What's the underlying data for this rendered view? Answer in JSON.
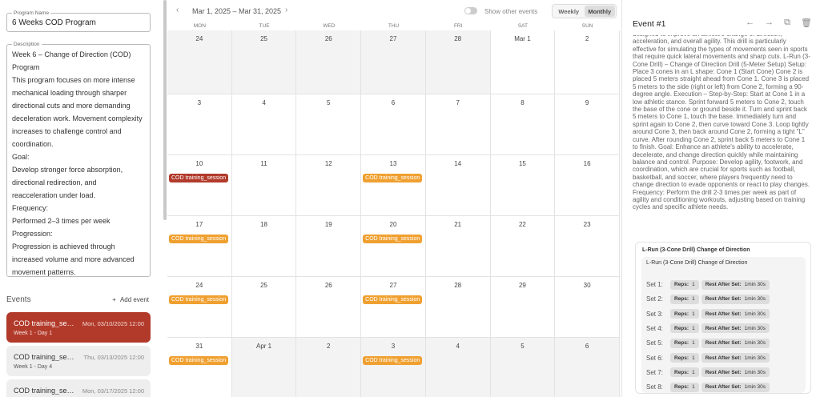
{
  "program": {
    "name_label": "Program Name",
    "name_value": "6 Weeks COD Program",
    "description_label": "Description",
    "description_lines": [
      "Week 6 – Change of Direction (COD)",
      "Program",
      "This program focuses on more intense",
      "mechanical loading through sharper",
      "directional cuts and more demanding",
      "deceleration work. Movement complexity",
      "increases to challenge control and",
      "coordination.",
      "Goal:",
      "Develop stronger force absorption,",
      "directional redirection, and",
      "reacceleration under load.",
      "Frequency:",
      "Performed 2–3 times per week",
      "Progression:",
      "Progression is achieved through",
      "increased volume and more advanced",
      "movement patterns."
    ]
  },
  "events_panel": {
    "title": "Events",
    "add_label": "Add event",
    "add_icon": "plus-icon",
    "items": [
      {
        "title": "COD training_session",
        "date": "Mon, 03/10/2025 12:00",
        "sub": "Week 1 - Day 1",
        "active": true
      },
      {
        "title": "COD training_session",
        "date": "Thu, 03/13/2025 12:00",
        "sub": "Week 1 - Day 4",
        "active": false
      },
      {
        "title": "COD training_session",
        "date": "Mon, 03/17/2025 12:00",
        "sub": "",
        "active": false
      }
    ]
  },
  "calendar": {
    "range": "Mar 1, 2025 – Mar 31, 2025",
    "prev_icon": "chevron-left-icon",
    "next_icon": "chevron-right-icon",
    "show_other_label": "Show other events",
    "views": [
      "Weekly",
      "Monthly"
    ],
    "active_view": "Monthly",
    "weekdays": [
      "MON",
      "TUE",
      "WED",
      "THU",
      "FRI",
      "SAT",
      "SUN"
    ],
    "weeks": [
      [
        {
          "n": "24",
          "off": true
        },
        {
          "n": "25",
          "off": true
        },
        {
          "n": "26",
          "off": true
        },
        {
          "n": "27",
          "off": true
        },
        {
          "n": "28",
          "off": true
        },
        {
          "n": "Mar 1",
          "off": false
        },
        {
          "n": "2",
          "off": false
        }
      ],
      [
        {
          "n": "3"
        },
        {
          "n": "4"
        },
        {
          "n": "5"
        },
        {
          "n": "6"
        },
        {
          "n": "7"
        },
        {
          "n": "8"
        },
        {
          "n": "9"
        }
      ],
      [
        {
          "n": "10",
          "ev": "COD training_session",
          "active": true
        },
        {
          "n": "11"
        },
        {
          "n": "12"
        },
        {
          "n": "13",
          "ev": "COD training_session"
        },
        {
          "n": "14"
        },
        {
          "n": "15"
        },
        {
          "n": "16"
        }
      ],
      [
        {
          "n": "17",
          "ev": "COD training_session"
        },
        {
          "n": "18"
        },
        {
          "n": "19"
        },
        {
          "n": "20",
          "ev": "COD training_session"
        },
        {
          "n": "21"
        },
        {
          "n": "22"
        },
        {
          "n": "23"
        }
      ],
      [
        {
          "n": "24",
          "ev": "COD training_session"
        },
        {
          "n": "25"
        },
        {
          "n": "26"
        },
        {
          "n": "27",
          "ev": "COD training_session"
        },
        {
          "n": "28"
        },
        {
          "n": "29"
        },
        {
          "n": "30"
        }
      ],
      [
        {
          "n": "31",
          "ev": "COD training_session"
        },
        {
          "n": "Apr 1",
          "off": true
        },
        {
          "n": "2",
          "off": true
        },
        {
          "n": "3",
          "off": true,
          "ev": "COD training_session"
        },
        {
          "n": "4",
          "off": true
        },
        {
          "n": "5",
          "off": true
        },
        {
          "n": "6",
          "off": true
        }
      ]
    ]
  },
  "event_detail": {
    "title": "Event #1",
    "icons": [
      "arrow-left-icon",
      "arrow-right-icon",
      "copy-icon",
      "trash-icon"
    ],
    "text": "designed to improve an athlete's change of direction, acceleration, and overall agility. This drill is particularly effective for simulating the types of movements seen in sports that require quick lateral movements and sharp cuts. L-Run (3-Cone Drill) – Change of Direction Drill (5-Meter Setup) Setup: Place 3 cones in an L shape: Cone 1 (Start Cone) Cone 2 is placed 5 meters straight ahead from Cone 1. Cone 3 is placed 5 meters to the side (right or left) from Cone 2, forming a 90-degree angle. Execution – Step-by-Step: Start at Cone 1 in a low athletic stance. Sprint forward 5 meters to Cone 2, touch the base of the cone or ground beside it. Turn and sprint back 5 meters to Cone 1, touch the base. Immediately turn and sprint again to Cone 2, then curve toward Cone 3. Loop tightly around Cone 3, then back around Cone 2, forming a tight \"L\" curve. After rounding Cone 2, sprint back 5 meters to Cone 1 to finish. Goal: Enhance an athlete's ability to accelerate, decelerate, and change direction quickly while maintaining balance and control. Purpose: Develop agility, footwork, and coordination, which are crucial for sports such as football, basketball, and soccer, where players frequently need to change direction to evade opponents or react to play changes. Frequency: Perform the drill 2-3 times per week as part of agility and conditioning workouts, adjusting based on training cycles and specific athlete needs.",
    "drill_title": "L-Run (3-Cone Drill) Change of Direction",
    "drill_sub": "L-Run (3-Cone Drill) Change of Direction",
    "sets": [
      {
        "label": "Set 1:",
        "reps_label": "Reps:",
        "reps": "1",
        "rest_label": "Rest After Set:",
        "rest": "1min 30s"
      },
      {
        "label": "Set 2:",
        "reps_label": "Reps:",
        "reps": "1",
        "rest_label": "Rest After Set:",
        "rest": "1min 30s"
      },
      {
        "label": "Set 3:",
        "reps_label": "Reps:",
        "reps": "1",
        "rest_label": "Rest After Set:",
        "rest": "1min 30s"
      },
      {
        "label": "Set 4:",
        "reps_label": "Reps:",
        "reps": "1",
        "rest_label": "Rest After Set:",
        "rest": "1min 30s"
      },
      {
        "label": "Set 5:",
        "reps_label": "Reps:",
        "reps": "1",
        "rest_label": "Rest After Set:",
        "rest": "1min 30s"
      },
      {
        "label": "Set 6:",
        "reps_label": "Reps:",
        "reps": "1",
        "rest_label": "Rest After Set:",
        "rest": "1min 30s"
      },
      {
        "label": "Set 7:",
        "reps_label": "Reps:",
        "reps": "1",
        "rest_label": "Rest After Set:",
        "rest": "1min 30s"
      },
      {
        "label": "Set 8:",
        "reps_label": "Reps:",
        "reps": "1",
        "rest_label": "Rest After Set:",
        "rest": "1min 30s"
      }
    ]
  },
  "colors": {
    "accent_active": "#b23a2b",
    "event_orange": "#f0a030"
  }
}
